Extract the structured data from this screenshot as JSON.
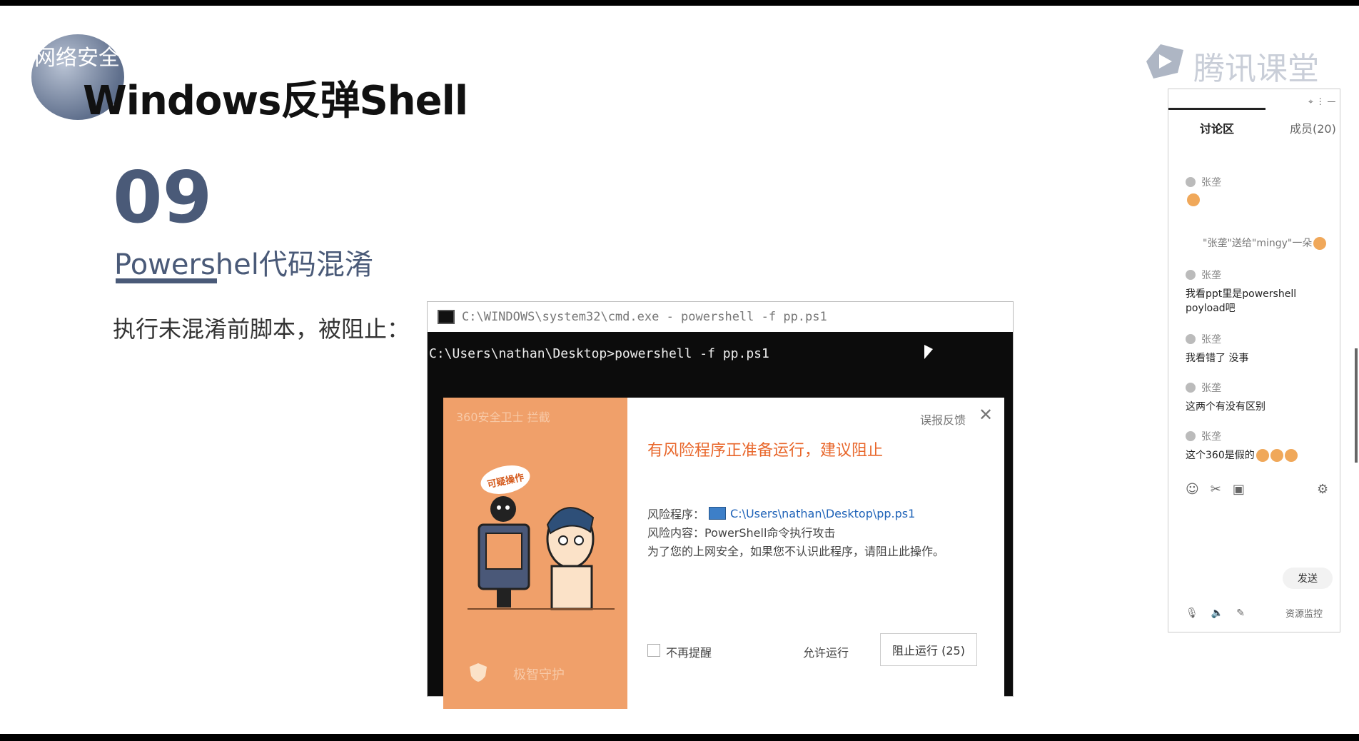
{
  "slide": {
    "brand_text": "网络安全",
    "title": "Windows反弹Shell",
    "section_number": "09",
    "section_subtitle": "Powershel代码混淆",
    "body_text": "执行未混淆前脚本，被阻止：",
    "tencent_logo": "腾讯课堂"
  },
  "cmd": {
    "title": "C:\\WINDOWS\\system32\\cmd.exe - powershell  -f pp.ps1",
    "command_line": "C:\\Users\\nathan\\Desktop>powershell -f pp.ps1"
  },
  "dialog": {
    "left_header": "360安全卫士 拦截",
    "bubble_text": "可疑操作",
    "left_footer": "极智守护",
    "feedback": "误报反馈",
    "close": "✕",
    "headline": "有风险程序正准备运行，建议阻止",
    "risk_program_label": "风险程序：",
    "risk_program_path": "C:\\Users\\nathan\\Desktop\\pp.ps1",
    "risk_content": "风险内容：PowerShell命令执行攻击",
    "advice": "为了您的上网安全，如果您不认识此程序，请阻止此操作。",
    "no_remind": "不再提醒",
    "allow": "允许运行",
    "block": "阻止运行 (25)"
  },
  "chat": {
    "tab_discussion": "讨论区",
    "tab_members": "成员(20)",
    "window_controls": "⌖ ⋮ —",
    "messages": [
      {
        "user": "张垄",
        "text": ""
      },
      {
        "user": "张垄",
        "text": "我看ppt里是powershell poyload吧"
      },
      {
        "user": "张垄",
        "text": "我看错了 没事"
      },
      {
        "user": "张垄",
        "text": "这两个有没有区别"
      },
      {
        "user": "张垄",
        "text": "这个360是假的"
      }
    ],
    "gift_notice": "\"张垄\"送给\"mingy\"一朵",
    "send": "发送",
    "resource_monitor": "资源监控"
  },
  "colors": {
    "accent_orange": "#f0a06a",
    "headline_orange": "#e8662a",
    "section_blue": "#4a5a78",
    "link_blue": "#1f63b8"
  }
}
